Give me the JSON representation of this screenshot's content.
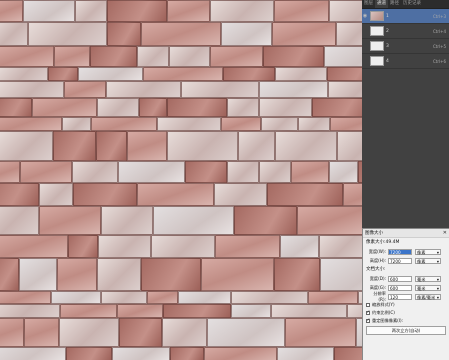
{
  "panel": {
    "tabs": [
      "图层",
      "通道",
      "路径",
      "历史记录"
    ],
    "active_tab": 1,
    "layers": [
      {
        "name": "1",
        "shortcut": "Ctrl+3",
        "selected": true
      },
      {
        "name": "2",
        "shortcut": "Ctrl+4",
        "selected": false
      },
      {
        "name": "3",
        "shortcut": "Ctrl+5",
        "selected": false
      },
      {
        "name": "4",
        "shortcut": "Ctrl+6",
        "selected": false
      }
    ]
  },
  "dialog": {
    "title": "图像大小",
    "pixel_size_label": "像素大小:49.4M",
    "width_label": "宽度(W):",
    "width_value": "7200",
    "width_unit": "像素",
    "height_label": "高度(H):",
    "height_value": "7200",
    "height_unit": "像素",
    "doc_size_label": "文档大小:",
    "doc_width_label": "宽度(D):",
    "doc_width_value": "600",
    "doc_width_unit": "毫米",
    "doc_height_label": "高度(G):",
    "doc_height_value": "600",
    "doc_height_unit": "毫米",
    "resolution_label": "分辨率(R):",
    "resolution_value": "120",
    "resolution_unit": "像素/毫米",
    "scale_styles": "缩放样式(Y)",
    "constrain": "约束比例(C)",
    "resample": "重定图像像素(I):",
    "resample_mode": "两次立方(自动)"
  },
  "colors": {
    "selected_layer": "#4e6fa3",
    "panel_bg": "#414141"
  }
}
